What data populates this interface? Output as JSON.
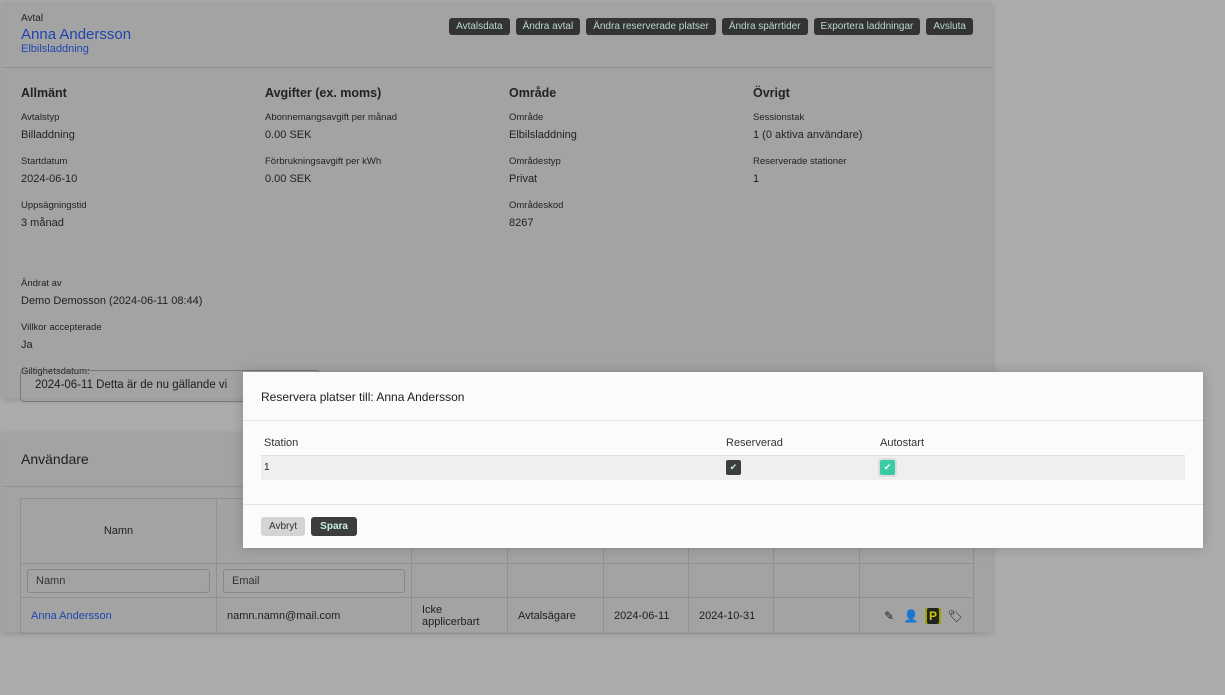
{
  "header": {
    "label": "Avtal",
    "name": "Anna Andersson",
    "subtitle": "Elbilsladdning",
    "buttons": [
      "Avtalsdata",
      "Ändra avtal",
      "Ändra reserverade platser",
      "Ändra spärrtider",
      "Exportera laddningar",
      "Avsluta"
    ]
  },
  "sections": [
    {
      "title": "Allmänt",
      "fields": [
        {
          "label": "Avtalstyp",
          "value": "Billaddning"
        },
        {
          "label": "Startdatum",
          "value": "2024-06-10"
        },
        {
          "label": "Uppsägningstid",
          "value": "3 månad"
        }
      ]
    },
    {
      "title": "Avgifter (ex. moms)",
      "fields": [
        {
          "label": "Abonnemangsavgift per månad",
          "value": "0.00 SEK"
        },
        {
          "label": "Förbrukningsavgift per kWh",
          "value": "0.00 SEK"
        }
      ]
    },
    {
      "title": "Område",
      "fields": [
        {
          "label": "Område",
          "value": "Elbilsladdning"
        },
        {
          "label": "Områdestyp",
          "value": "Privat"
        },
        {
          "label": "Områdeskod",
          "value": "8267"
        }
      ]
    },
    {
      "title": "Övrigt",
      "fields": [
        {
          "label": "Sessionstak",
          "value": "1 (0 aktiva användare)"
        },
        {
          "label": "Reserverade stationer",
          "value": "1"
        }
      ]
    }
  ],
  "extra": {
    "changed_by_label": "Ändrat av",
    "changed_by": "Demo Demosson (2024-06-11 08:44)",
    "terms_label": "Villkor accepterade",
    "terms": "Ja",
    "validity_label": "Giltighetsdatum:",
    "validity_value": "2024-06-11   Detta är de nu gällande vi"
  },
  "users": {
    "title": "Användare",
    "col_name": "Namn",
    "filter_name": "Namn",
    "filter_email": "Email",
    "row": {
      "name": "Anna Andersson",
      "email": "namn.namn@mail.com",
      "applicable": "Icke applicerbart",
      "role": "Avtalsägare",
      "start": "2024-06-11",
      "end": "2024-10-31",
      "parking_icon": "P"
    }
  },
  "modal": {
    "title": "Reservera platser till: Anna Andersson",
    "col_station": "Station",
    "col_reserved": "Reserverad",
    "col_autostart": "Autostart",
    "rows": [
      {
        "station": "1",
        "reserved": true,
        "autostart": true
      }
    ],
    "cancel": "Avbryt",
    "save": "Spara",
    "colors": {
      "reserved": "#3d3d3d",
      "autostart": "#3cc9a6"
    }
  }
}
